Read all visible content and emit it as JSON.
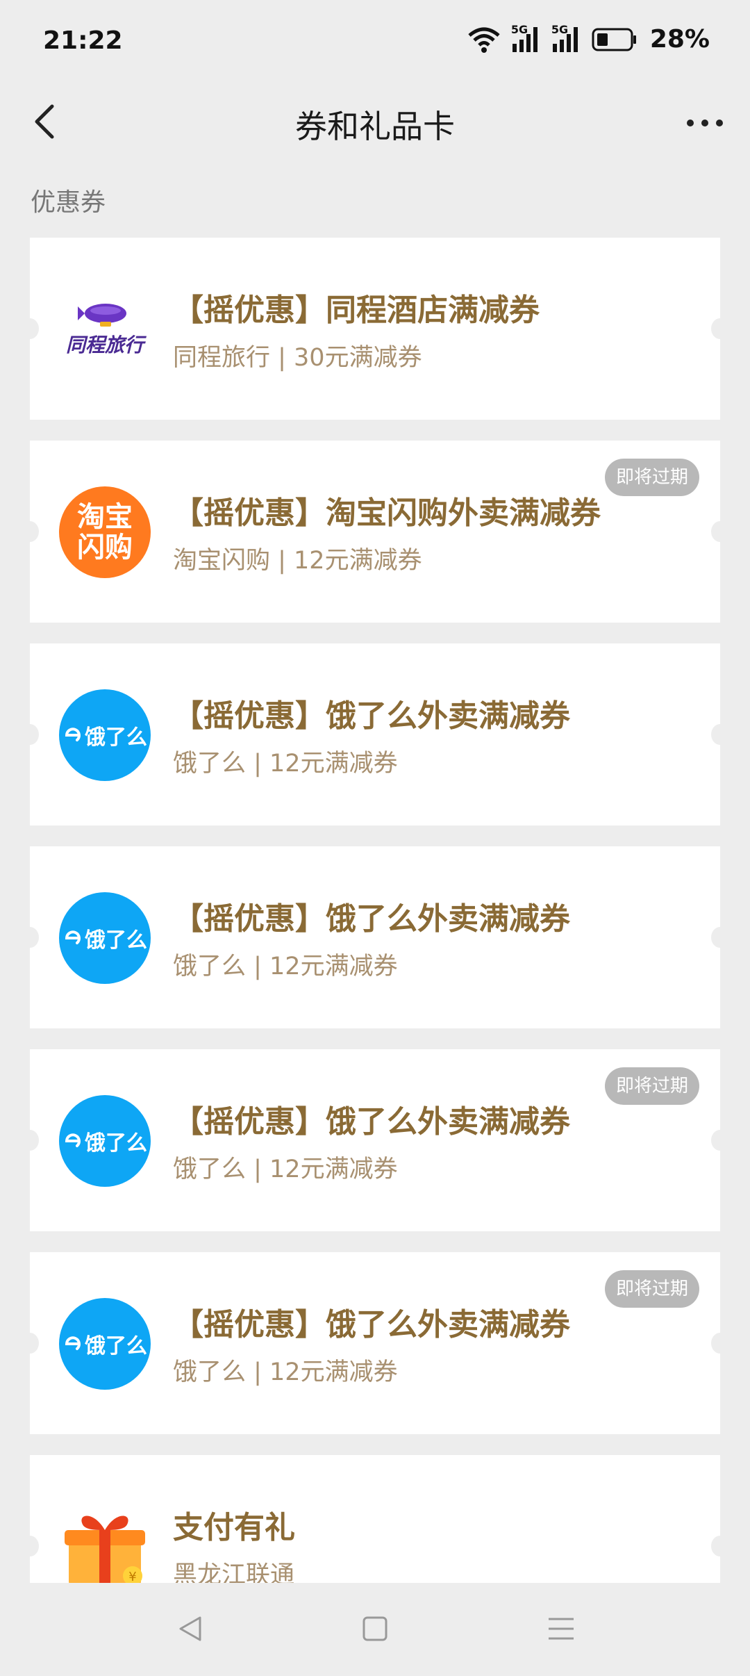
{
  "status": {
    "time": "21:22",
    "signal1": "5G",
    "signal2": "5G",
    "battery": "28%"
  },
  "nav": {
    "title": "券和礼品卡"
  },
  "section": {
    "title": "优惠券"
  },
  "coupons": [
    {
      "title": "【摇优惠】同程酒店满减券",
      "subtitle": "同程旅行 | 30元满减券",
      "logo": "tongcheng-logo",
      "logo_text": "同程旅行",
      "expiring": ""
    },
    {
      "title": "【摇优惠】淘宝闪购外卖满减券",
      "subtitle": "淘宝闪购 | 12元满减券",
      "logo": "taobao-shangou-logo",
      "logo_line1": "淘宝",
      "logo_line2": "闪购",
      "expiring": "即将过期"
    },
    {
      "title": "【摇优惠】饿了么外卖满减券",
      "subtitle": "饿了么 | 12元满减券",
      "logo": "eleme-logo",
      "logo_text": "饿了么",
      "expiring": ""
    },
    {
      "title": "【摇优惠】饿了么外卖满减券",
      "subtitle": "饿了么 | 12元满减券",
      "logo": "eleme-logo",
      "logo_text": "饿了么",
      "expiring": ""
    },
    {
      "title": "【摇优惠】饿了么外卖满减券",
      "subtitle": "饿了么 | 12元满减券",
      "logo": "eleme-logo",
      "logo_text": "饿了么",
      "expiring": "即将过期"
    },
    {
      "title": "【摇优惠】饿了么外卖满减券",
      "subtitle": "饿了么 | 12元满减券",
      "logo": "eleme-logo",
      "logo_text": "饿了么",
      "expiring": "即将过期"
    },
    {
      "title": "支付有礼",
      "subtitle": "黑龙江联通",
      "logo": "gift-box-icon",
      "expiring": ""
    }
  ],
  "colors": {
    "background": "#ededed",
    "card": "#ffffff",
    "title_gold": "#8a6a35",
    "subtitle": "#a89070",
    "badge": "#b8b8b8",
    "taobao_orange": "#ff7a1f",
    "eleme_blue": "#0ea6f5"
  }
}
